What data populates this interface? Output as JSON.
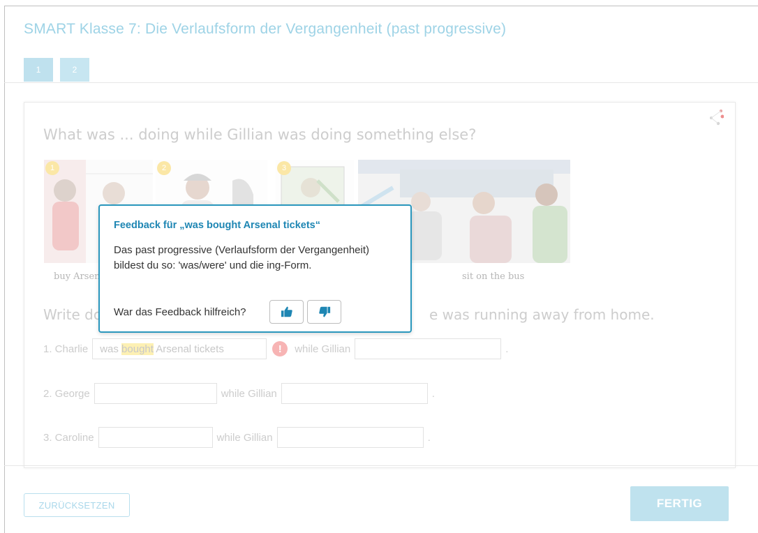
{
  "app": {
    "title": "SMART Klasse 7: Die Verlaufsform der Vergangenheit (past progressive)",
    "pages": [
      "1",
      "2"
    ]
  },
  "exercise": {
    "question": "What was ... doing while Gillian was doing something else?",
    "pictures": [
      {
        "number": "1",
        "caption": "buy Arsenal tickets"
      },
      {
        "number": "2",
        "caption": ""
      },
      {
        "number": "3",
        "caption": ""
      },
      {
        "number": "",
        "caption": "sit on the bus"
      }
    ],
    "instruction_visible_start": "Write do",
    "instruction_visible_end": "e was running away from home.",
    "rows": [
      {
        "label": "1. Charlie",
        "answer_prefix": "was ",
        "answer_highlight": "bought",
        "answer_suffix": " Arsenal tickets",
        "connector": "while Gillian",
        "second_value": "",
        "end": "."
      },
      {
        "label": "2. George",
        "answer": "",
        "connector": "while Gillian",
        "second_value": "",
        "end": "."
      },
      {
        "label": "3. Caroline",
        "answer": "",
        "connector": "while Gillian",
        "second_value": "",
        "end": "."
      }
    ],
    "error_icon": "exclamation-icon"
  },
  "feedback": {
    "title": "Feedback für „was bought Arsenal tickets“",
    "body": "Das past progressive (Verlaufsform der Vergangenheit) bildest du so: 'was/were' und die ing-Form.",
    "question": "War das Feedback hilfreich?",
    "thumbs_up_icon": "thumbs-up-icon",
    "thumbs_down_icon": "thumbs-down-icon",
    "accent": "#2a97bd"
  },
  "footer": {
    "reset_label": "ZURÜCKSETZEN",
    "done_label": "FERTIG"
  }
}
